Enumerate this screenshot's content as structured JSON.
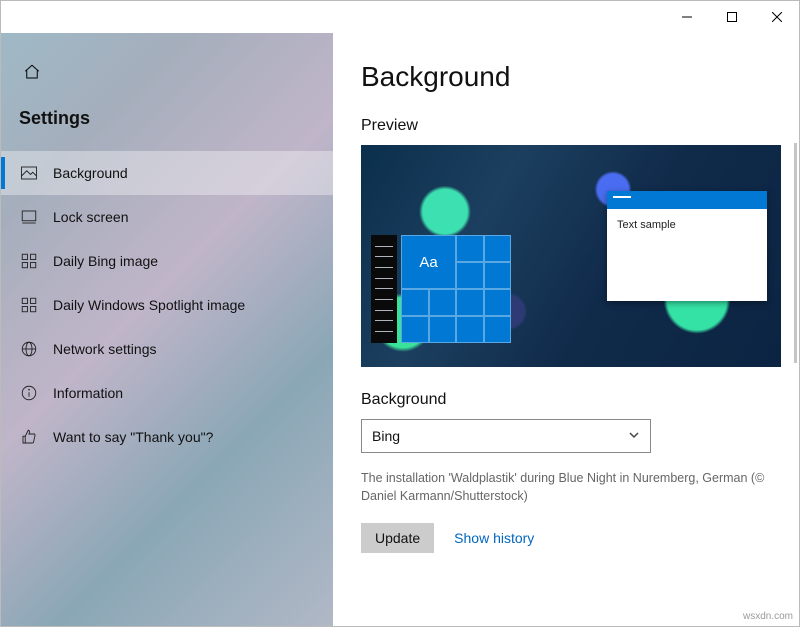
{
  "window": {
    "minimize_tooltip": "Minimize",
    "maximize_tooltip": "Maximize",
    "close_tooltip": "Close"
  },
  "sidebar": {
    "heading": "Settings",
    "items": [
      {
        "label": "Background",
        "icon": "image-icon",
        "active": true
      },
      {
        "label": "Lock screen",
        "icon": "lock-screen-icon",
        "active": false
      },
      {
        "label": "Daily Bing image",
        "icon": "grid-icon",
        "active": false
      },
      {
        "label": "Daily Windows Spotlight image",
        "icon": "grid-icon",
        "active": false
      },
      {
        "label": "Network settings",
        "icon": "globe-icon",
        "active": false
      },
      {
        "label": "Information",
        "icon": "info-icon",
        "active": false
      },
      {
        "label": "Want to say \"Thank you\"?",
        "icon": "thumbs-up-icon",
        "active": false
      }
    ]
  },
  "main": {
    "title": "Background",
    "preview_label": "Preview",
    "preview": {
      "aa_text": "Aa",
      "sample_text": "Text sample"
    },
    "background_label": "Background",
    "background_selected": "Bing",
    "caption": "The installation 'Waldplastik' during Blue Night in Nuremberg, German (© Daniel Karmann/Shutterstock)",
    "update_label": "Update",
    "history_label": "Show history"
  },
  "watermark": "wsxdn.com"
}
